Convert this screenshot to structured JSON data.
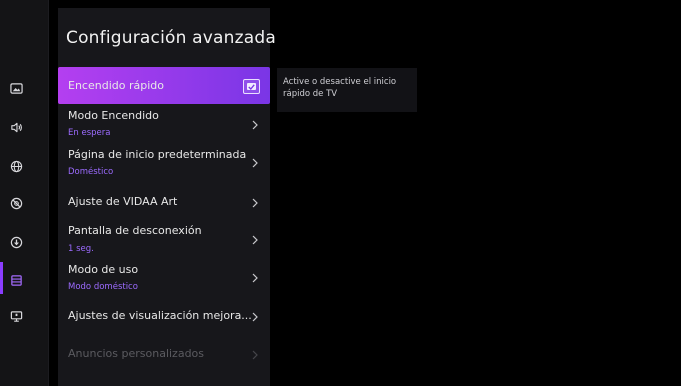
{
  "colors": {
    "accent": "#8b3dff",
    "selected_gradient_start": "#b43ff0",
    "selected_gradient_end": "#7a36e6",
    "value_text": "#9c6bff"
  },
  "rail": {
    "icons": [
      "picture-icon",
      "sound-icon",
      "network-icon",
      "accessibility-icon",
      "support-icon",
      "system-icon",
      "device-icon"
    ],
    "active_icon": "system-icon"
  },
  "panel": {
    "title": "Configuración avanzada",
    "items": [
      {
        "label": "Encendido rápido",
        "control": "checkbox",
        "checked": true,
        "selected": true
      },
      {
        "label": "Modo Encendido",
        "value": "En espera"
      },
      {
        "label": "Página de inicio predeterminada",
        "value": "Doméstico"
      },
      {
        "label": "Ajuste de VIDAA Art"
      },
      {
        "label": "Pantalla de desconexión",
        "value": "1 seg."
      },
      {
        "label": "Modo de uso",
        "value": "Modo doméstico"
      },
      {
        "label": "Ajustes de visualización mejora..."
      },
      {
        "label": "Anuncios personalizados",
        "disabled": true
      }
    ]
  },
  "tooltip": {
    "text": "Active o desactive el inicio rápido de TV"
  }
}
